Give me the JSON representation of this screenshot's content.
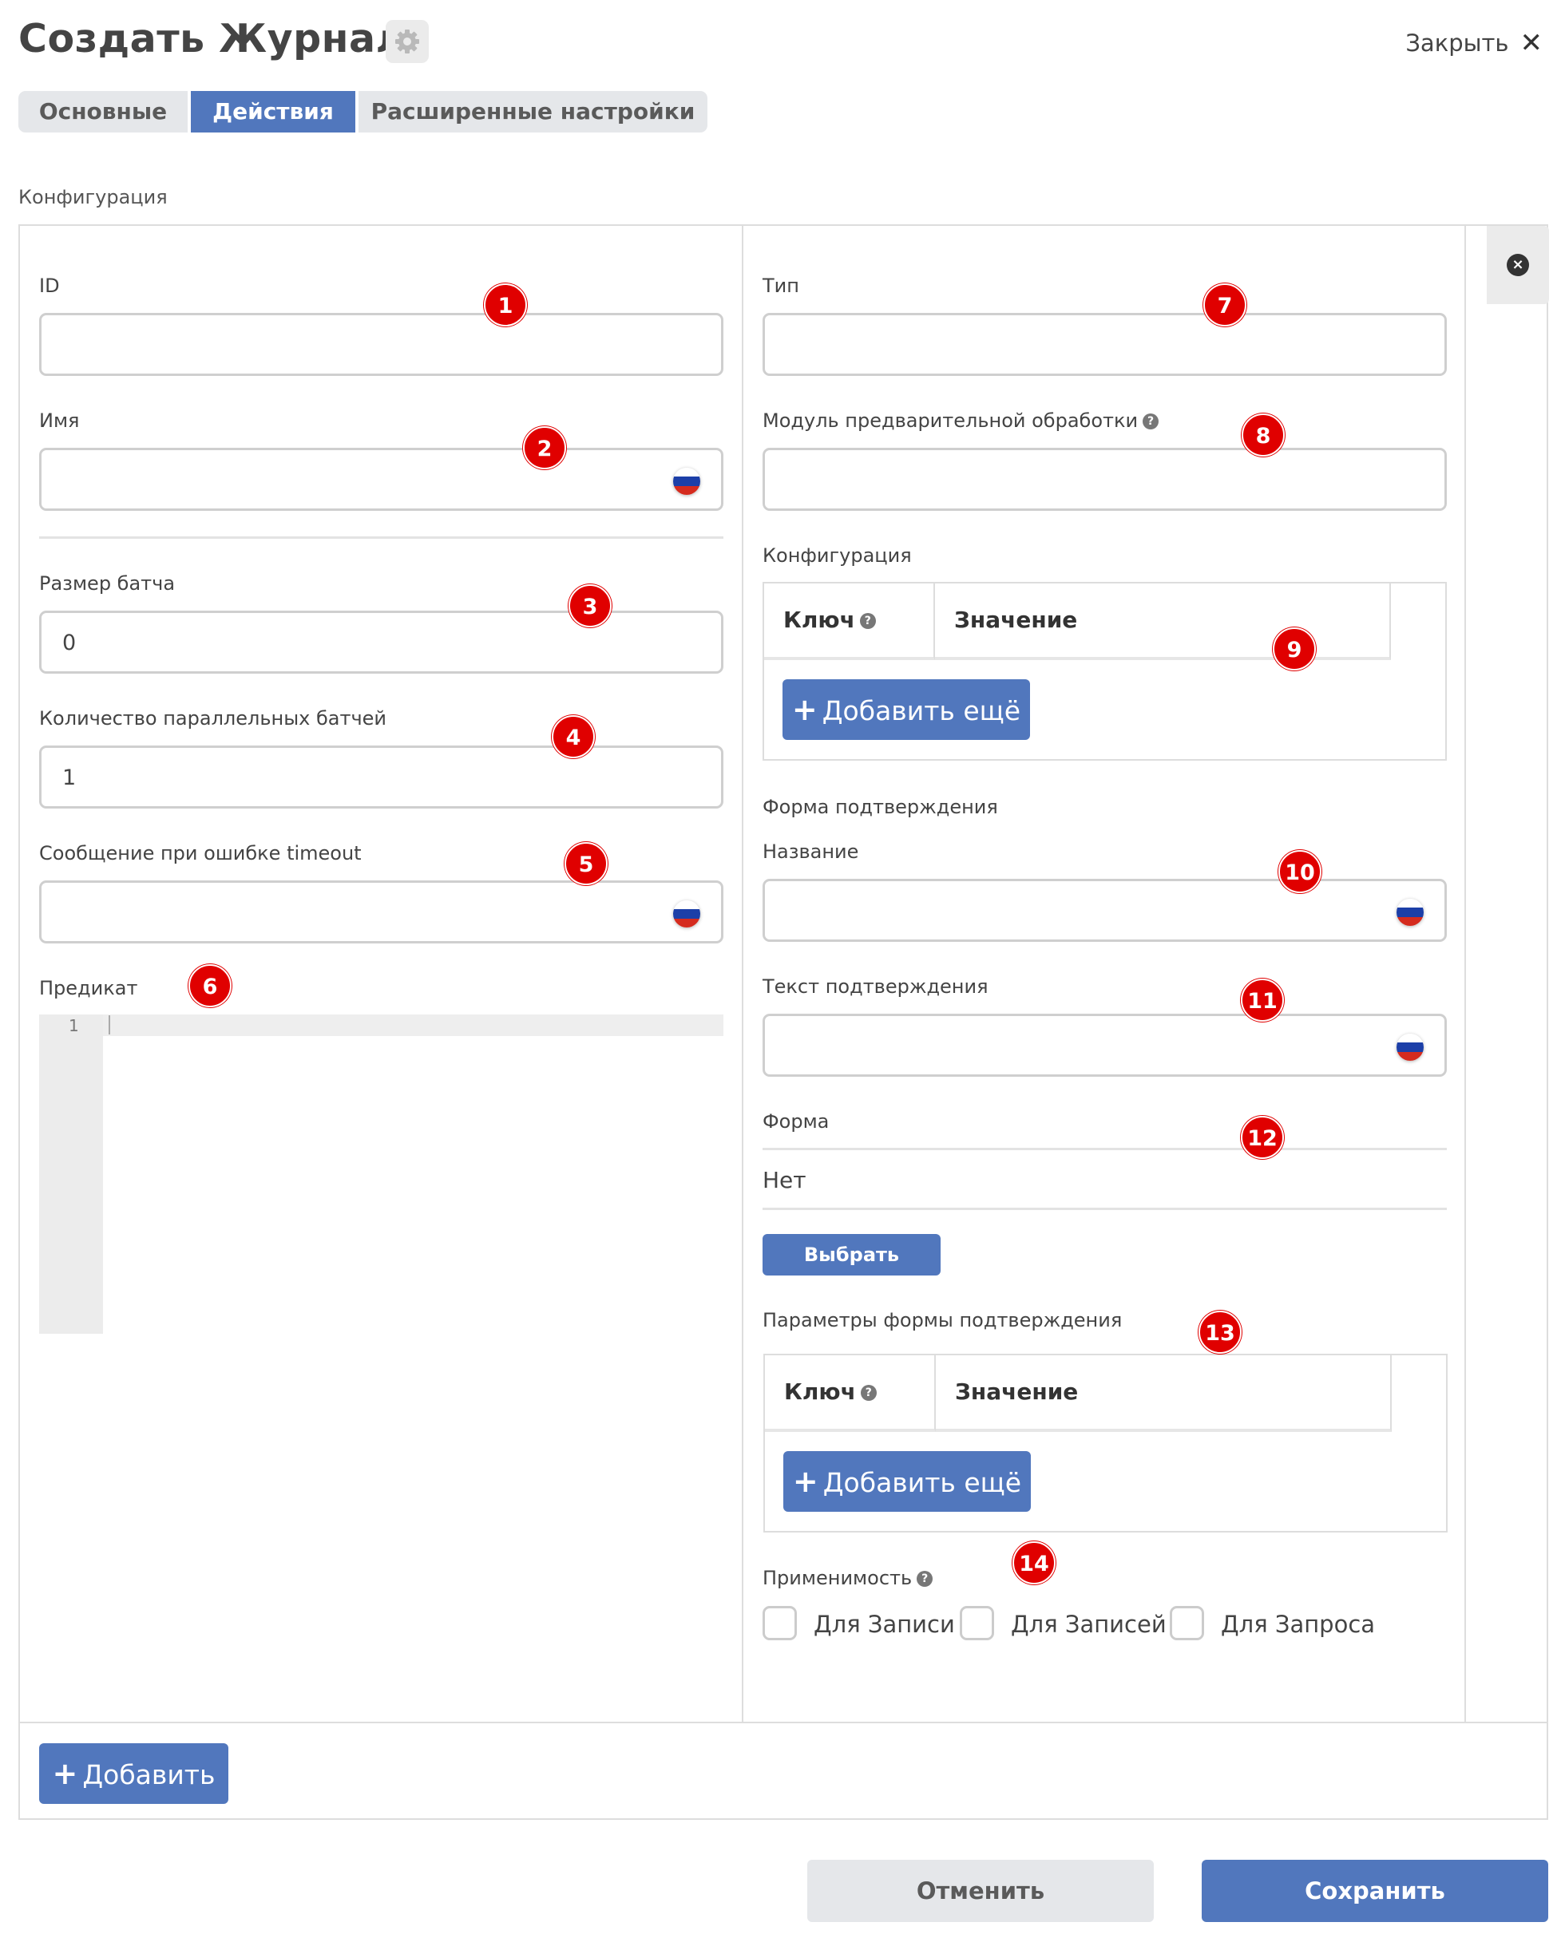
{
  "header": {
    "title": "Создать Журнал",
    "close_label": "Закрыть",
    "close_icon": "✕"
  },
  "tabs": [
    {
      "label": "Основные",
      "active": false
    },
    {
      "label": "Действия",
      "active": true
    },
    {
      "label": "Расширенные настройки",
      "active": false
    }
  ],
  "section_label": "Конфигурация",
  "left": {
    "id_label": "ID",
    "name_label": "Имя",
    "batch_size_label": "Размер батча",
    "batch_size_value": "0",
    "parallel_label": "Количество параллельных батчей",
    "parallel_value": "1",
    "timeout_msg_label": "Сообщение при ошибке timeout",
    "predicate_label": "Предикат",
    "code_line_number": "1"
  },
  "right": {
    "type_label": "Тип",
    "preprocess_label": "Модуль предварительной обработки",
    "config_label": "Конфигурация",
    "config_key_header": "Ключ",
    "config_value_header": "Значение",
    "add_more_label": "Добавить ещё",
    "confirm_form_label": "Форма подтверждения",
    "confirm_title_label": "Название",
    "confirm_text_label": "Текст подтверждения",
    "form_label": "Форма",
    "form_value": "Нет",
    "choose_label": "Выбрать",
    "confirm_params_label": "Параметры формы подтверждения",
    "params_key_header": "Ключ",
    "params_value_header": "Значение",
    "params_add_more_label": "Добавить ещё",
    "applicability_label": "Применимость",
    "applicability_options": [
      "Для Записи",
      "Для Записей",
      "Для Запроса"
    ]
  },
  "add_button_label": "Добавить",
  "footer": {
    "cancel_label": "Отменить",
    "save_label": "Сохранить"
  },
  "badges": [
    "1",
    "2",
    "3",
    "4",
    "5",
    "6",
    "7",
    "8",
    "9",
    "10",
    "11",
    "12",
    "13",
    "14"
  ],
  "colors": {
    "accent": "#5177bd",
    "badge": "#e00000",
    "border": "#dddddd"
  },
  "icons": {
    "flag": "russia-flag-icon",
    "help": "help-icon",
    "remove": "remove-circle-icon",
    "settings": "gear-icon"
  }
}
